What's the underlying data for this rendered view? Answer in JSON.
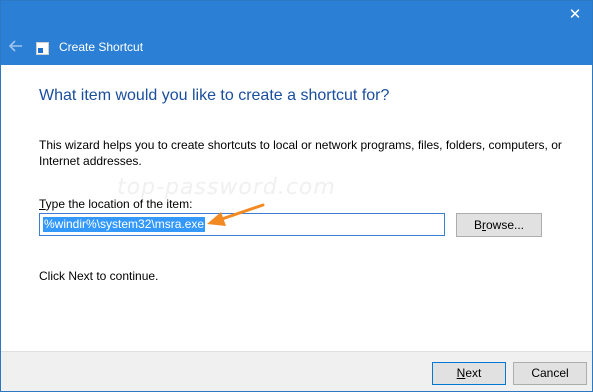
{
  "window": {
    "title": "Create Shortcut",
    "close_glyph": "✕",
    "back_icon": "back-arrow-icon",
    "app_icon": "shortcut-icon"
  },
  "wizard": {
    "heading": "What item would you like to create a shortcut for?",
    "description": "This wizard helps you to create shortcuts to local or network programs, files, folders, computers, or Internet addresses.",
    "location_label_accel": "T",
    "location_label_rest": "ype the location of the item:",
    "location_value": "%windir%\\system32\\msra.exe",
    "browse_accel": "r",
    "browse_before": "B",
    "browse_after": "owse...",
    "continue_text": "Click Next to continue.",
    "watermark": "top-password.com"
  },
  "footer": {
    "next_accel": "N",
    "next_rest": "ext",
    "cancel_label": "Cancel"
  },
  "colors": {
    "titlebar": "#2b7fd4",
    "heading": "#1a4e9e",
    "selection": "#3399ff",
    "annotation_arrow": "#f28a21"
  }
}
